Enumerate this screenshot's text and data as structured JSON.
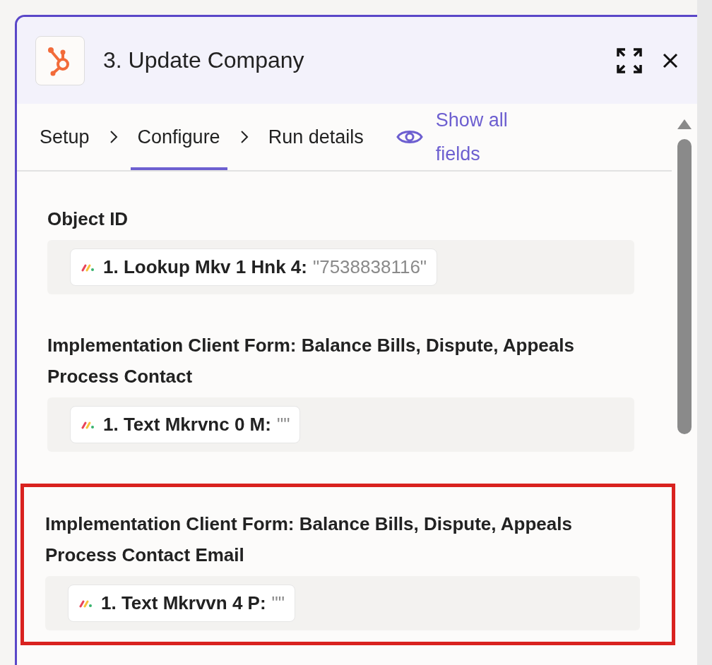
{
  "panel": {
    "title": "3. Update Company"
  },
  "tabs": [
    {
      "label": "Setup",
      "selected": false
    },
    {
      "label": "Configure",
      "selected": true
    },
    {
      "label": "Run details",
      "selected": false
    }
  ],
  "show_all_fields": "Show all fields",
  "fields": [
    {
      "label": "Object ID",
      "highlighted": false,
      "pill": {
        "label": "1. Lookup Mkv 1 Hnk 4:",
        "value": "\"7538838116\""
      }
    },
    {
      "label": "Implementation Client Form: Balance Bills, Dispute, Appeals Process Contact",
      "highlighted": false,
      "pill": {
        "label": "1. Text Mkrvnc 0 M:",
        "value": "\"\""
      }
    },
    {
      "label": "Implementation Client Form: Balance Bills, Dispute, Appeals Process Contact Email",
      "highlighted": true,
      "pill": {
        "label": "1. Text Mkrvvn 4 P:",
        "value": "\"\""
      }
    }
  ]
}
